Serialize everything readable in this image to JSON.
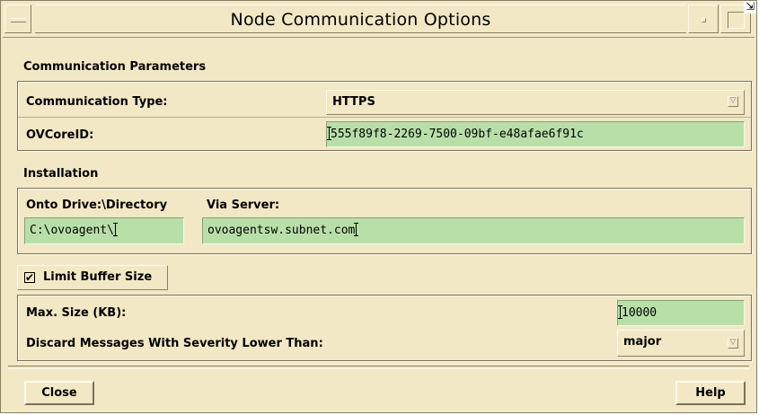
{
  "window": {
    "title": "Node Communication Options",
    "corner_icon": "resize-corner-icon"
  },
  "communication": {
    "section_label": "Communication Parameters",
    "type_label": "Communication Type:",
    "type_value": "HTTPS",
    "corelid_label": "OVCoreID:",
    "corelid_value": "555f89f8-2269-7500-09bf-e48afae6f91c"
  },
  "installation": {
    "section_label": "Installation",
    "drive_label": "Onto Drive:\\Directory",
    "drive_value": "C:\\ovoagent\\",
    "server_label": "Via Server:",
    "server_value": "ovoagentsw.subnet.com"
  },
  "buffer": {
    "checkbox_label": "Limit Buffer Size",
    "checked": true,
    "max_size_label": "Max. Size (KB):",
    "max_size_value": "10000",
    "discard_label": "Discard Messages With Severity Lower Than:",
    "discard_value": "major"
  },
  "buttons": {
    "close": "Close",
    "help": "Help"
  },
  "colors": {
    "background": "#f3e8c5",
    "field": "#b8dfa8"
  }
}
